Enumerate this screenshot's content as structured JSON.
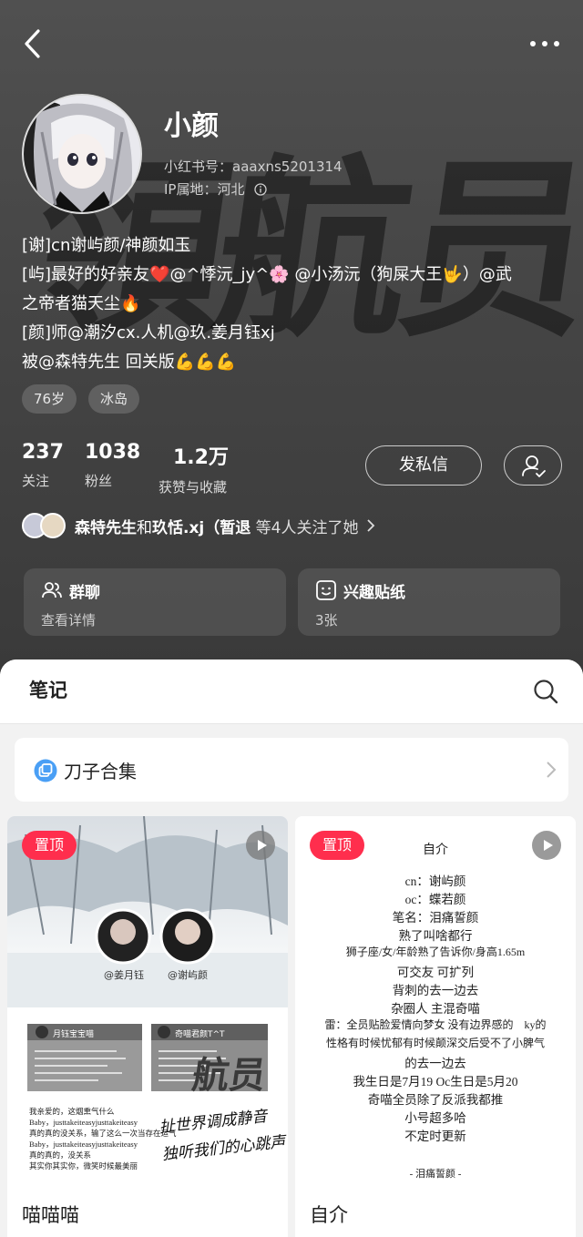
{
  "profile": {
    "name": "小颜",
    "id_line": "小红书号：aaaxns5201314",
    "ip_line": "IP属地：河北",
    "background_text": "領航员",
    "bio": [
      "[谢]cn谢屿颜/神颜如玉",
      "[屿]最好的好亲友❤️@^悸沅_jy^🌸 @小汤沅（狗屎大王🤟）@武",
      "之帝者猫天尘🔥",
      "[颜]师@潮汐cx.人机@玖.姜月钰xj",
      "被@森特先生 回关版💪💪💪"
    ],
    "tags": [
      "76岁",
      "冰岛"
    ]
  },
  "stats": [
    {
      "num": "237",
      "label": "关注"
    },
    {
      "num": "1038",
      "label": "粉丝"
    },
    {
      "num": "1.2万",
      "label": "获赞与收藏"
    }
  ],
  "actions": {
    "message_label": "发私信"
  },
  "mutual": {
    "name1": "森特先生",
    "conj": "和",
    "name2": "玖恬.xj（暂退",
    "suffix": " 等4人关注了她"
  },
  "cards": [
    {
      "title": "群聊",
      "sub": "查看详情",
      "icon": "group-icon"
    },
    {
      "title": "兴趣贴纸",
      "sub": "3张",
      "icon": "sticker-icon"
    }
  ],
  "notes_section": {
    "title": "笔记",
    "collection_label": "刀子合集"
  },
  "notes": [
    {
      "pin_label": "置顶",
      "title": "喵喵喵",
      "avatar_label_left": "@姜月钰",
      "avatar_label_right": "@谢屿颜",
      "panel_left": "月钰宝宝喵",
      "panel_right": "奇喵君颜T^T",
      "panel_right_calli": "航员",
      "poem": [
        "我亲爱的，这烟熏气什么",
        "Baby，justtakeiteasyjusttakeiteasy",
        "真的真的没关系，输了这么一次当存在运气",
        "Baby，justtakeiteasyjusttakeiteasy",
        "真的真的，没关系",
        "其实你其实你，微笑时候最美丽"
      ],
      "calligraphy": [
        "扯世界调成静音",
        "独听我们的心跳声"
      ]
    },
    {
      "pin_label": "置顶",
      "title": "自介",
      "intro": [
        "自介",
        "cn：谢屿颜",
        "oc：蝶若颜",
        "笔名：泪痛誓颜",
        "熟了叫啥都行",
        "狮子座/女/年龄熟了告诉你/身高1.65m",
        "可交友 可扩列",
        "背刺的去一边去",
        "杂圈人 主混奇喵",
        "雷：全员贴脸爱情向梦女 没有边界感的　ky的",
        "性格有时候忧郁有时候颠深交后受不了小脾气",
        "的去一边去",
        "我生日是7月19  Oc生日是5月20",
        "奇喵全员除了反派我都推",
        "小号超多哈",
        "不定时更新",
        "- 泪痛誓颜 -"
      ]
    }
  ]
}
